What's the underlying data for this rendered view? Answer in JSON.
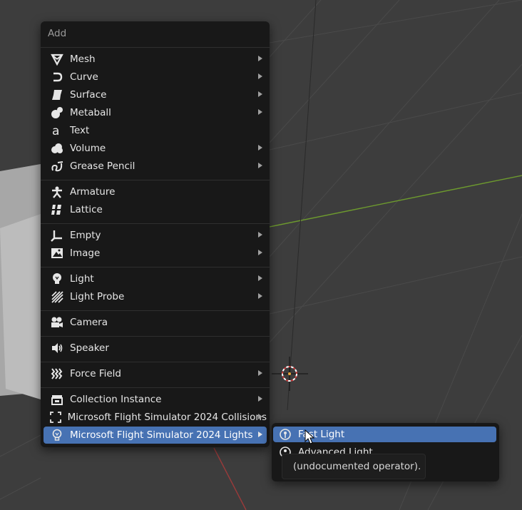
{
  "menu": {
    "title": "Add",
    "items": [
      {
        "label": "Mesh",
        "icon": "mesh-icon",
        "submenu": true
      },
      {
        "label": "Curve",
        "icon": "curve-icon",
        "submenu": true
      },
      {
        "label": "Surface",
        "icon": "surface-icon",
        "submenu": true
      },
      {
        "label": "Metaball",
        "icon": "metaball-icon",
        "submenu": true
      },
      {
        "label": "Text",
        "icon": "text-icon",
        "submenu": false
      },
      {
        "label": "Volume",
        "icon": "volume-icon",
        "submenu": true
      },
      {
        "label": "Grease Pencil",
        "icon": "grease-pencil-icon",
        "submenu": true
      },
      {
        "label": "Armature",
        "icon": "armature-icon",
        "submenu": false
      },
      {
        "label": "Lattice",
        "icon": "lattice-icon",
        "submenu": false
      },
      {
        "label": "Empty",
        "icon": "empty-icon",
        "submenu": true
      },
      {
        "label": "Image",
        "icon": "image-icon",
        "submenu": true
      },
      {
        "label": "Light",
        "icon": "light-icon",
        "submenu": true
      },
      {
        "label": "Light Probe",
        "icon": "light-probe-icon",
        "submenu": true
      },
      {
        "label": "Camera",
        "icon": "camera-icon",
        "submenu": false
      },
      {
        "label": "Speaker",
        "icon": "speaker-icon",
        "submenu": false
      },
      {
        "label": "Force Field",
        "icon": "force-field-icon",
        "submenu": true
      },
      {
        "label": "Collection Instance",
        "icon": "collection-instance-icon",
        "submenu": true
      },
      {
        "label": "Microsoft Flight Simulator 2024 Collisions",
        "icon": "collisions-icon",
        "submenu": true
      },
      {
        "label": "Microsoft Flight Simulator 2024 Lights",
        "icon": "light-icon",
        "submenu": true,
        "active": true
      }
    ]
  },
  "submenu": {
    "items": [
      {
        "label": "Fast Light",
        "icon": "light-icon"
      },
      {
        "label": "Advanced Light",
        "icon": "light-icon"
      }
    ]
  },
  "tooltip": {
    "text": "(undocumented operator)."
  },
  "colors": {
    "menu_bg": "#181818",
    "highlight": "#4772b3",
    "viewport_bg": "#3d3d3d",
    "y_axis": "#6d9a2e",
    "x_axis": "#9b3a3a"
  }
}
